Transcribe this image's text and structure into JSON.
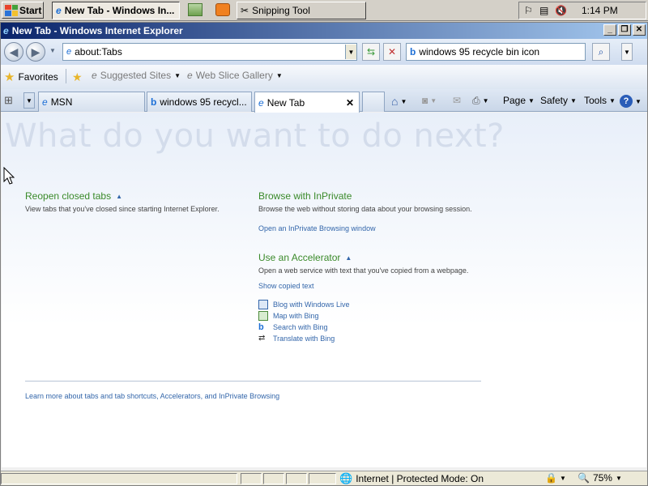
{
  "taskbar": {
    "start_label": "Start",
    "tasks": [
      {
        "label": "New Tab - Windows In..."
      },
      {
        "label": "Snipping Tool"
      }
    ],
    "clock": "1:14 PM"
  },
  "window": {
    "title": "New Tab - Windows Internet Explorer",
    "controls": {
      "minimize": "_",
      "restore": "❐",
      "close": "✕"
    }
  },
  "navbar": {
    "back_icon": "back-arrow",
    "forward_icon": "forward-arrow",
    "address_value": "about:Tabs",
    "search_value": "windows 95 recycle bin icon"
  },
  "favorites": {
    "favorites_label": "Favorites",
    "suggested_sites_label": "Suggested Sites",
    "web_slice_label": "Web Slice Gallery"
  },
  "tabs": [
    {
      "label": "MSN"
    },
    {
      "label": "windows 95 recycl..."
    },
    {
      "label": "New Tab"
    }
  ],
  "commandbar": {
    "page_label": "Page",
    "safety_label": "Safety",
    "tools_label": "Tools"
  },
  "content": {
    "headline": "What do you want to do next?",
    "reopen": {
      "title": "Reopen closed tabs",
      "desc": "View tabs that you've closed since starting Internet Explorer."
    },
    "inprivate": {
      "title": "Browse with InPrivate",
      "desc": "Browse the web without storing data about your browsing session.",
      "link": "Open an InPrivate Browsing window"
    },
    "accelerator": {
      "title": "Use an Accelerator",
      "desc": "Open a web service with text that you've copied from a webpage.",
      "show_link": "Show copied text",
      "items": [
        {
          "label": "Blog with Windows Live"
        },
        {
          "label": "Map with Bing"
        },
        {
          "label": "Search with Bing"
        },
        {
          "label": "Translate with Bing"
        }
      ]
    },
    "footer_link": "Learn more about tabs and tab shortcuts, Accelerators, and InPrivate Browsing"
  },
  "statusbar": {
    "zone_text": "Internet | Protected Mode: On",
    "zoom": "75%"
  },
  "colors": {
    "title_bar": "#0a246a",
    "section_title": "#3a8a2a",
    "link": "#3366aa"
  }
}
